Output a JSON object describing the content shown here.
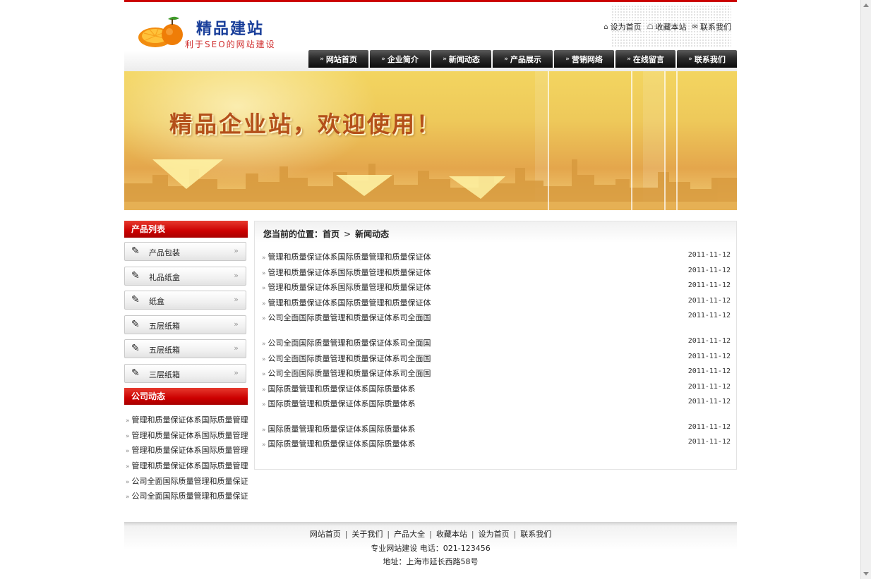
{
  "header": {
    "logo_title": "精品建站",
    "logo_subtitle": "利于SEO的网站建设",
    "top_links": [
      {
        "label": "设为首页",
        "icon": "home-icon"
      },
      {
        "label": "收藏本站",
        "icon": "bookmark-icon"
      },
      {
        "label": "联系我们",
        "icon": "contact-icon"
      }
    ],
    "nav": [
      "网站首页",
      "企业简介",
      "新闻动态",
      "产品展示",
      "营销网络",
      "在线留言",
      "联系我们"
    ]
  },
  "banner": {
    "title": "精品企业站，欢迎使用！"
  },
  "sidebar": {
    "products_title": "产品列表",
    "products": [
      "产品包装",
      "礼品纸盒",
      "纸盒",
      "五层纸箱",
      "五层纸箱",
      "三层纸箱"
    ],
    "news_title": "公司动态",
    "news": [
      "管理和质量保证体系国际质量管理",
      "管理和质量保证体系国际质量管理",
      "管理和质量保证体系国际质量管理",
      "管理和质量保证体系国际质量管理",
      "公司全面国际质量管理和质量保证",
      "公司全面国际质量管理和质量保证"
    ]
  },
  "main": {
    "breadcrumb_prefix": "您当前的位置：首页",
    "breadcrumb_sep": ">",
    "breadcrumb_current": "新闻动态",
    "news": [
      {
        "title": "管理和质量保证体系国际质量管理和质量保证体",
        "date": "2011-11-12"
      },
      {
        "title": "管理和质量保证体系国际质量管理和质量保证体",
        "date": "2011-11-12"
      },
      {
        "title": "管理和质量保证体系国际质量管理和质量保证体",
        "date": "2011-11-12"
      },
      {
        "title": "管理和质量保证体系国际质量管理和质量保证体",
        "date": "2011-11-12"
      },
      {
        "title": "公司全面国际质量管理和质量保证体系司全面国",
        "date": "2011-11-12"
      },
      {
        "title": "公司全面国际质量管理和质量保证体系司全面国",
        "date": "2011-11-12"
      },
      {
        "title": "公司全面国际质量管理和质量保证体系司全面国",
        "date": "2011-11-12"
      },
      {
        "title": "公司全面国际质量管理和质量保证体系司全面国",
        "date": "2011-11-12"
      },
      {
        "title": "国际质量管理和质量保证体系国际质量体系",
        "date": "2011-11-12"
      },
      {
        "title": "国际质量管理和质量保证体系国际质量体系",
        "date": "2011-11-12"
      },
      {
        "title": "国际质量管理和质量保证体系国际质量体系",
        "date": "2011-11-12"
      },
      {
        "title": "国际质量管理和质量保证体系国际质量体系",
        "date": "2011-11-12"
      }
    ]
  },
  "footer": {
    "links": [
      "网站首页",
      "关于我们",
      "产品大全",
      "收藏本站",
      "设为首页",
      "联系我们"
    ],
    "link_sep": "|",
    "contact": "专业网站建设 电话：021-123456",
    "address": "地址：上海市延长西路58号"
  },
  "colors": {
    "brand_red": "#cc0000",
    "nav_black": "#1a1a1a",
    "banner_gold": "#eec95a"
  }
}
